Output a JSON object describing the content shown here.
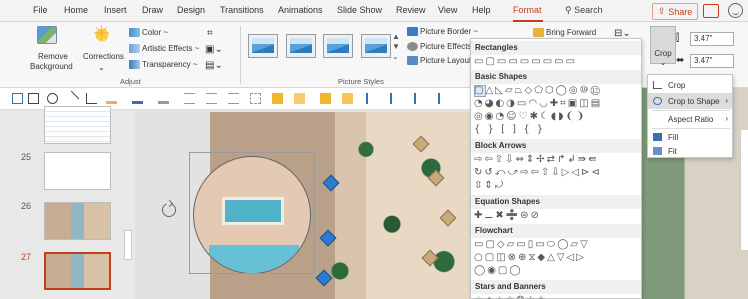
{
  "tabs": [
    {
      "label": "File"
    },
    {
      "label": "Home"
    },
    {
      "label": "Insert"
    },
    {
      "label": "Draw"
    },
    {
      "label": "Design"
    },
    {
      "label": "Transitions"
    },
    {
      "label": "Animations"
    },
    {
      "label": "Slide Show"
    },
    {
      "label": "Review"
    },
    {
      "label": "View"
    },
    {
      "label": "Help"
    },
    {
      "label": "Format"
    }
  ],
  "search": {
    "label": "Search"
  },
  "share": {
    "label": "Share"
  },
  "ribbon": {
    "remove_background": {
      "line1": "Remove",
      "line2": "Background"
    },
    "corrections": {
      "label": "Corrections"
    },
    "color": {
      "label": "Color ~"
    },
    "artistic_effects": {
      "label": "Artistic Effects ~"
    },
    "transparency": {
      "label": "Transparency ~"
    },
    "adjust_group": {
      "label": "Adjust"
    },
    "picture_styles_group": {
      "label": "Picture Styles"
    },
    "picture_border": {
      "label": "Picture Border ~"
    },
    "picture_effects": {
      "label": "Picture Effects"
    },
    "picture_layout": {
      "label": "Picture Layout"
    },
    "bring_forward": {
      "label": "Bring Forward"
    },
    "crop": {
      "label": "Crop"
    },
    "height": {
      "value": "3.47\""
    },
    "width": {
      "value": "3.47\""
    }
  },
  "shapes_menu": {
    "sections": [
      {
        "title": "Rectangles",
        "rows": [
          "▭▢▭▭▭▭▭▭▭"
        ]
      },
      {
        "title": "Basic Shapes",
        "rows": [
          "▢△◺▱⏢◇⬠⬡◯◎⑩⑫",
          "◔◕◐◑▭◠◡✚⌗▣◫▤",
          "◎◉◔☺♡✱☾◖◗❨❩",
          "{ } [ ] { }"
        ]
      },
      {
        "title": "Block Arrows",
        "rows": [
          "⇨⇦⇧⇩⇔⇕✢⇄↱↲⇛⇚",
          "↻↺⤺⤻⇨⇦⇧⇩▷◁⊳⊲",
          "⇳⇕⤾"
        ]
      },
      {
        "title": "Equation Shapes",
        "rows": [
          "✚⚊✖➗⊜⊘"
        ]
      },
      {
        "title": "Flowchart",
        "rows": [
          "▭▢◇▱▭▯▭⬭◯▱▽",
          "○▢◫⊗⊕⧖◆△▽◁▷",
          "◯◉▢◯"
        ]
      },
      {
        "title": "Stars and Banners",
        "rows": []
      }
    ]
  },
  "crop_menu": {
    "items": [
      {
        "label": "Crop",
        "has_arrow": false,
        "active": false
      },
      {
        "label": "Crop to Shape",
        "has_arrow": true,
        "active": true
      },
      {
        "label": "Aspect Ratio",
        "has_arrow": true,
        "active": false
      },
      {
        "label": "Fill",
        "has_arrow": false,
        "active": false
      },
      {
        "label": "Fit",
        "has_arrow": false,
        "active": false
      }
    ]
  },
  "slides": [
    {
      "number": "25"
    },
    {
      "number": "26"
    },
    {
      "number": "27"
    }
  ],
  "colors": {
    "accent": "#c43e1c",
    "ribbon_bg": "#f7f7f7",
    "tab_bg": "#f3f3f3"
  }
}
